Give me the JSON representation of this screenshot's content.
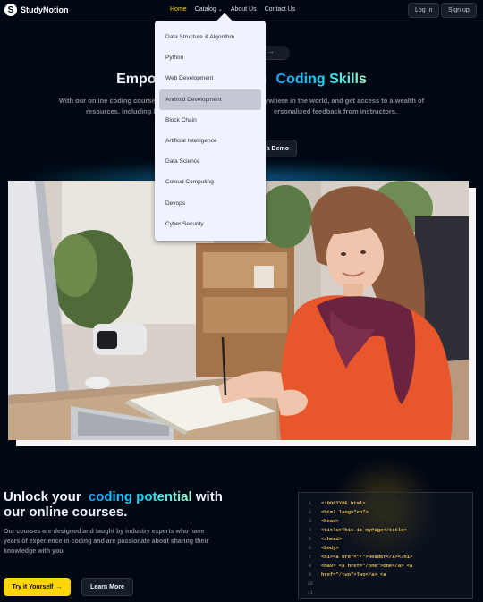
{
  "nav": {
    "brand": "StudyNotion",
    "brand_letter": "S",
    "links": [
      {
        "label": "Home",
        "active": true
      },
      {
        "label": "Catalog",
        "active": false
      },
      {
        "label": "About Us",
        "active": false
      },
      {
        "label": "Contact Us",
        "active": false
      }
    ],
    "login_label": "Log In",
    "signup_label": "Sign up"
  },
  "catalog_dropdown": {
    "items": [
      "Data Structure & Algorithm",
      "Python",
      "Web Development",
      "Android Development",
      "Block Chain",
      "Artificial Intelligence",
      "Data Science",
      "Coloud Computing",
      "Devops",
      "Cyber Security"
    ],
    "hovered": "Android Development"
  },
  "hero": {
    "title_prefix": "Empow",
    "title_mid": "th",
    "title_highlight": "Coding Skills",
    "subtitle_left_1": "With our online coding courses, you",
    "subtitle_right_1": "anywhere in the world, and get access to a wealth of",
    "subtitle_left_2": "resources, including h",
    "subtitle_right_2": "ersonalized feedback from instructors.",
    "demo_label": "a Demo"
  },
  "section": {
    "title_1": "Unlock your",
    "title_highlight": "coding potential",
    "title_2": "with",
    "title_3": "our online courses.",
    "description": "Our courses are designed and taught by industry experts who have years of experience in coding and are passionate about sharing their knowledge with you.",
    "try_label": "Try it Yourself",
    "learn_label": "Learn More"
  },
  "code_block": {
    "line_numbers": [
      "1",
      "2",
      "3",
      "4",
      "5",
      "6",
      "7",
      "8",
      "9",
      "10",
      "11"
    ],
    "lines": [
      "<!DOCTYPE html>",
      "<html lang=\"en\">",
      "<head>",
      "<title>This is myPage</title>",
      "</head>",
      "<body>",
      "<h1><a href=\"/\">Header</a></h1>",
      "<nav> <a href=\"/one\">One</a> <a",
      "href=\"/two\">Two</a> <a",
      "",
      ""
    ],
    "color": "#e7bc5b"
  },
  "colors": {
    "background": "#000814",
    "accent_yellow": "#ffd60a",
    "gradient_blue": "#12d8fa"
  }
}
